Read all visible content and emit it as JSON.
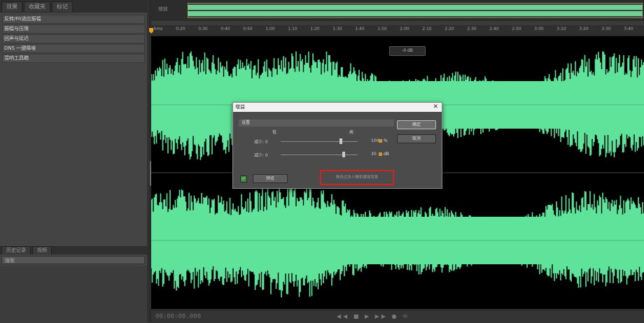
{
  "left_panel": {
    "tabs": [
      "效果",
      "收藏夹",
      "标记"
    ],
    "effects": [
      "反转/Fit适应振幅",
      "振幅与压限",
      "回声与延迟",
      "DNS 一键降噪",
      "混响工具箱"
    ],
    "lower_tabs": [
      "历史记录",
      "视频"
    ],
    "lower_field": "搜索"
  },
  "overview": {
    "zoom_label": "缩放"
  },
  "ruler": {
    "ticks": [
      "hms",
      "0:20",
      "0:30",
      "0:40",
      "0:50",
      "1:00",
      "1:10",
      "1:20",
      "1:30",
      "1:40",
      "1:50",
      "2:00",
      "2:10",
      "2:20",
      "2:30",
      "2:40",
      "2:50",
      "3:00",
      "3:10",
      "3:20",
      "3:30",
      "3:40"
    ]
  },
  "hud": {
    "label": "-0 dB"
  },
  "waveform": {
    "color": "#5fe39b",
    "background": "#000000",
    "channels": 2
  },
  "dialog": {
    "title": "增益",
    "settings_label": "设置",
    "col_left": "低",
    "col_right": "高",
    "rows": [
      {
        "label": "减少: 0",
        "value": "100",
        "unit": "%",
        "level_percent": 78
      },
      {
        "label": "减少: 0",
        "value": "30",
        "unit": "dB",
        "level_percent": 82
      }
    ],
    "ok_label": "确定",
    "cancel_label": "取消",
    "preview_label": "预览",
    "info_text": "降低过多人聲和環境背景"
  },
  "bottom": {
    "timecode": "00:00:00.000",
    "transport": "◀◀ ■ ▶ ▶▶ ● ⟲"
  }
}
